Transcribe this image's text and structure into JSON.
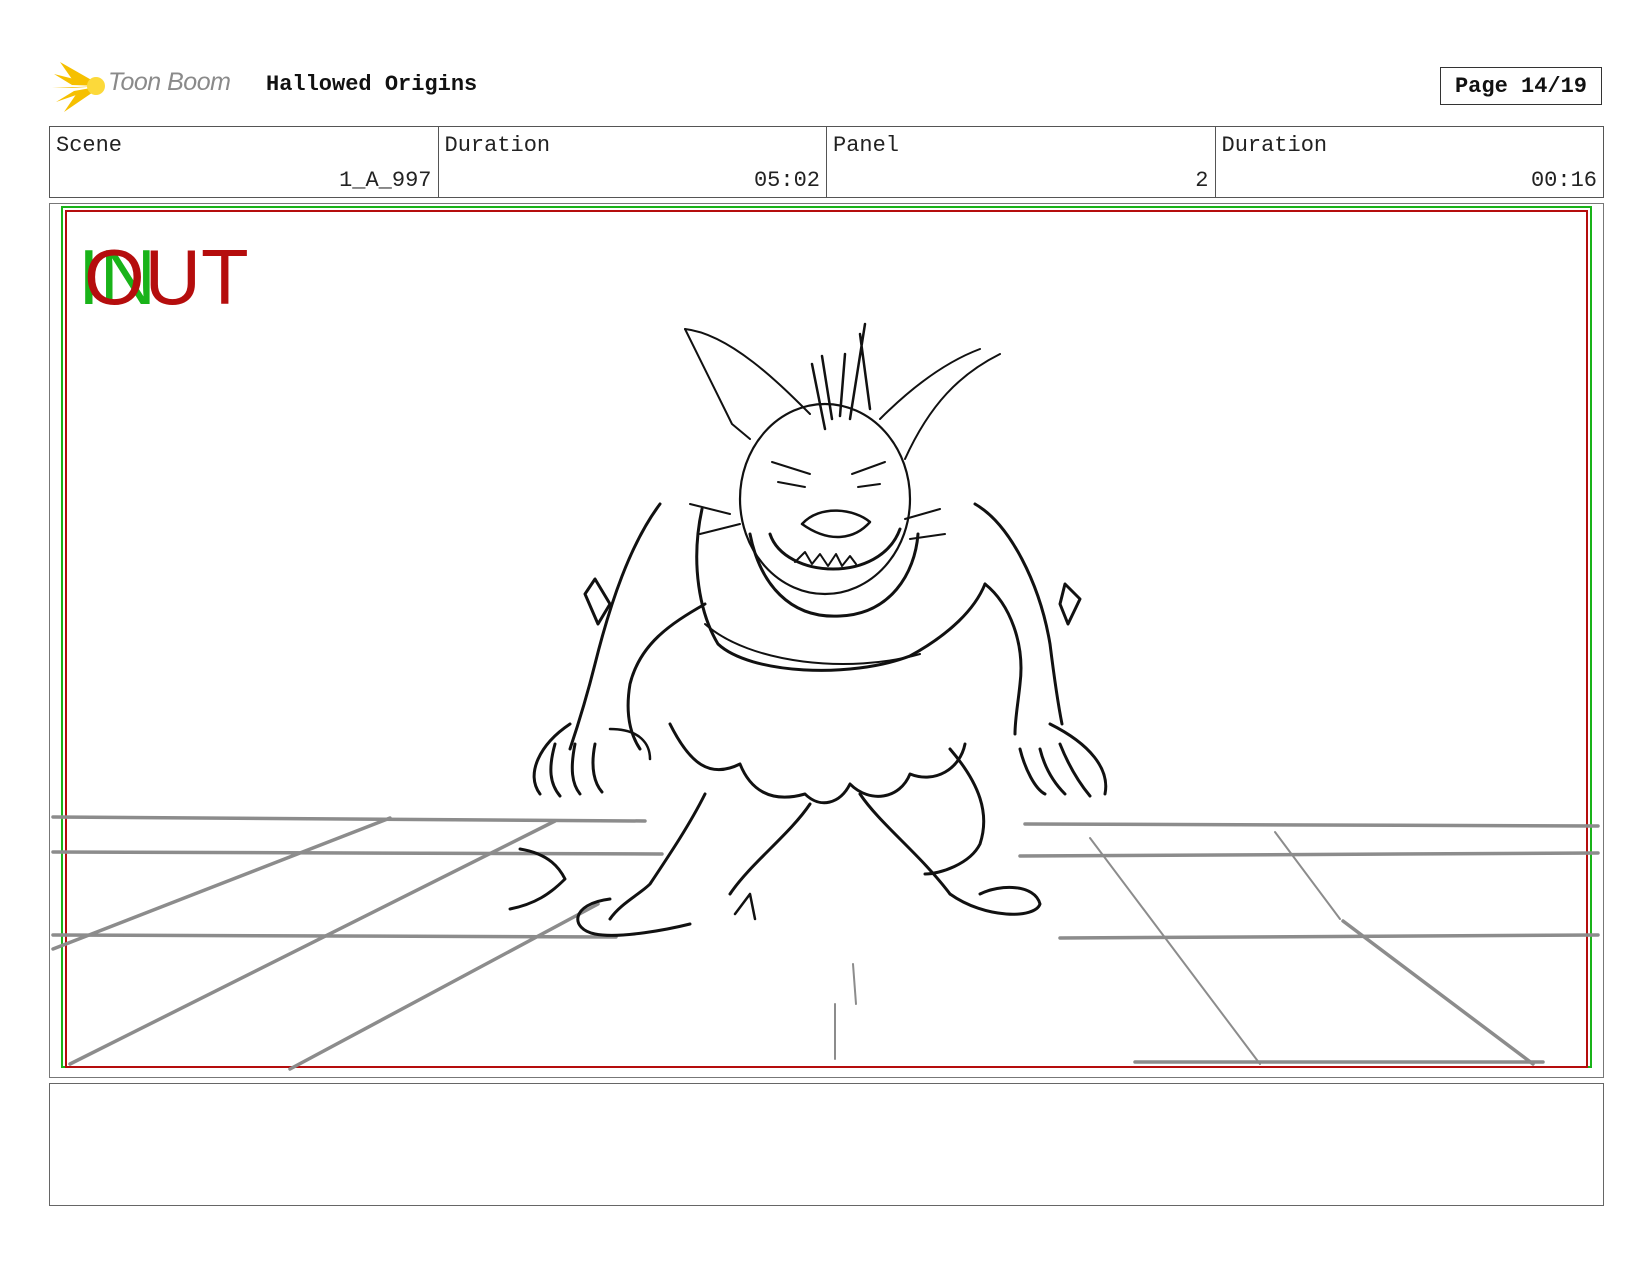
{
  "header": {
    "logo_text": "Toon Boom",
    "project_title": "Hallowed Origins",
    "page_label": "Page 14/19"
  },
  "info": {
    "scene_label": "Scene",
    "scene_value": "1_A_997",
    "scene_duration_label": "Duration",
    "scene_duration_value": "05:02",
    "panel_label": "Panel",
    "panel_value": "2",
    "panel_duration_label": "Duration",
    "panel_duration_value": "00:16"
  },
  "panel_marks": {
    "in_label": "IN",
    "out_label": "OUT",
    "in_color": "#19b319",
    "out_color": "#b50d0d"
  },
  "notes": {
    "text": ""
  },
  "colors": {
    "safe_frame_green": "#19b319",
    "safe_frame_red": "#b50d0d",
    "sketch_line": "#111111",
    "floor_line": "#888888"
  }
}
